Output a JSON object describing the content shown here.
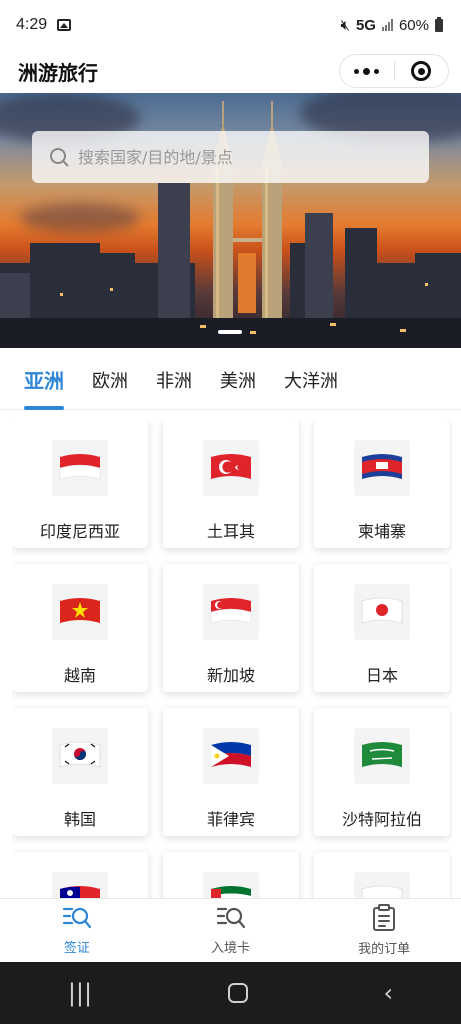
{
  "status_bar": {
    "time": "4:29",
    "network": "5G",
    "battery": "60%"
  },
  "app": {
    "title": "洲游旅行"
  },
  "search": {
    "placeholder": "搜索国家/目的地/景点"
  },
  "tabs": [
    {
      "label": "亚洲",
      "active": true
    },
    {
      "label": "欧洲",
      "active": false
    },
    {
      "label": "非洲",
      "active": false
    },
    {
      "label": "美洲",
      "active": false
    },
    {
      "label": "大洋洲",
      "active": false
    }
  ],
  "countries": [
    {
      "name": "印度尼西亚",
      "flag": "indonesia-flag"
    },
    {
      "name": "土耳其",
      "flag": "turkey-flag"
    },
    {
      "name": "柬埔寨",
      "flag": "cambodia-flag"
    },
    {
      "name": "越南",
      "flag": "vietnam-flag"
    },
    {
      "name": "新加坡",
      "flag": "singapore-flag"
    },
    {
      "name": "日本",
      "flag": "japan-flag"
    },
    {
      "name": "韩国",
      "flag": "korea-flag"
    },
    {
      "name": "菲律宾",
      "flag": "philippines-flag"
    },
    {
      "name": "沙特阿拉伯",
      "flag": "saudi-arabia-flag"
    },
    {
      "name": "",
      "flag": "taiwan-flag"
    },
    {
      "name": "",
      "flag": "uae-flag"
    },
    {
      "name": "",
      "flag": "partial-flag"
    }
  ],
  "bottom_nav": [
    {
      "label": "签证",
      "icon": "visa-search-icon",
      "active": true
    },
    {
      "label": "入境卡",
      "icon": "entry-card-icon",
      "active": false
    },
    {
      "label": "我的订单",
      "icon": "clipboard-icon",
      "active": false
    }
  ],
  "colors": {
    "accent": "#2f86d6"
  }
}
